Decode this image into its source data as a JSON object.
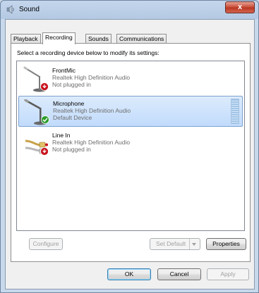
{
  "window": {
    "title": "Sound",
    "close_label": "x"
  },
  "tabs": [
    {
      "label": "Playback",
      "active": false
    },
    {
      "label": "Recording",
      "active": true
    },
    {
      "label": "Sounds",
      "active": false
    },
    {
      "label": "Communications",
      "active": false
    }
  ],
  "instruction": "Select a recording device below to modify its settings:",
  "devices": [
    {
      "name": "FrontMic",
      "driver": "Realtek High Definition Audio",
      "status": "Not plugged in",
      "icon": "microphone-icon",
      "badge": "unplugged-badge-icon",
      "selected": false
    },
    {
      "name": "Microphone",
      "driver": "Realtek High Definition Audio",
      "status": "Default Device",
      "icon": "microphone-icon",
      "badge": "default-check-badge-icon",
      "selected": true
    },
    {
      "name": "Line In",
      "driver": "Realtek High Definition Audio",
      "status": "Not plugged in",
      "icon": "line-in-cable-icon",
      "badge": "unplugged-badge-icon",
      "selected": false
    }
  ],
  "panel_buttons": {
    "configure": "Configure",
    "set_default": "Set Default",
    "properties": "Properties"
  },
  "dialog_buttons": {
    "ok": "OK",
    "cancel": "Cancel",
    "apply": "Apply"
  },
  "colors": {
    "selection": "#c1dbfc",
    "badge_red": "#c8141e",
    "badge_green": "#2a9d2a",
    "close": "#c74b36"
  }
}
